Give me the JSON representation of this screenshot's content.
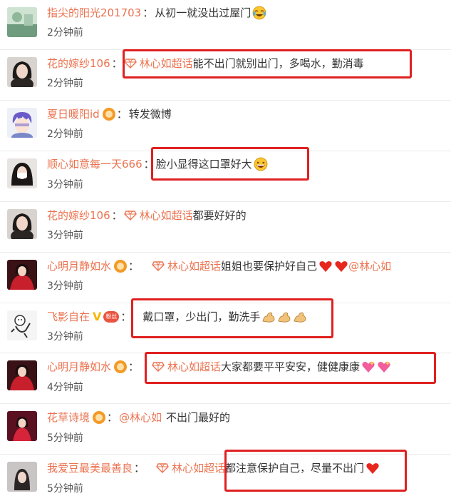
{
  "comments": [
    {
      "username": "指尖的阳光201703",
      "colon": "：",
      "text": "从初一就没出过屋门",
      "time": "2分钟前",
      "emoji": "laughing-crying-emoji"
    },
    {
      "username": "花的嫁纱106",
      "colon": "：",
      "topic": "林心如超话",
      "text": "能不出门就别出门，多喝水，勤消毒",
      "time": "2分钟前"
    },
    {
      "username": "夏日暖阳id",
      "colon": "：",
      "text": "转发微博",
      "time": "2分钟前"
    },
    {
      "username": "顺心如意每一天666",
      "colon": "：",
      "text": "脸小显得这口罩好大",
      "time": "3分钟前",
      "emoji": "grinning-emoji"
    },
    {
      "username": "花的嫁纱106",
      "colon": "：",
      "topic": "林心如超话",
      "text": "都要好好的",
      "time": "3分钟前"
    },
    {
      "username": "心明月静如水",
      "colon": "：",
      "topic": "林心如超话",
      "text": "姐姐也要保护好自己",
      "mention": "@林心如",
      "time": "3分钟前",
      "emoji": "heart-emoji"
    },
    {
      "username": "飞影自在",
      "colon": "：",
      "text": "戴口罩，少出门，勤洗手",
      "time": "3分钟前",
      "emoji": "muscle-emoji",
      "fan_badge": "粉丝"
    },
    {
      "username": "心明月静如水",
      "colon": "：",
      "topic": "林心如超话",
      "text": "大家都要平平安安，健健康康",
      "time": "4分钟前",
      "emoji": "sparkling-heart-emoji"
    },
    {
      "username": "花草诗境",
      "colon": "：",
      "mention": "@林心如",
      "text": "不出门最好的",
      "time": "5分钟前"
    },
    {
      "username": "我爱豆最美最善良",
      "colon": "：",
      "topic": "林心如超话",
      "text": "都注意保护自己，尽量不出门",
      "time": "5分钟前",
      "emoji": "heart-emoji"
    }
  ],
  "colors": {
    "username": "#eb7350",
    "highlight": "#e02020",
    "text": "#333333"
  }
}
